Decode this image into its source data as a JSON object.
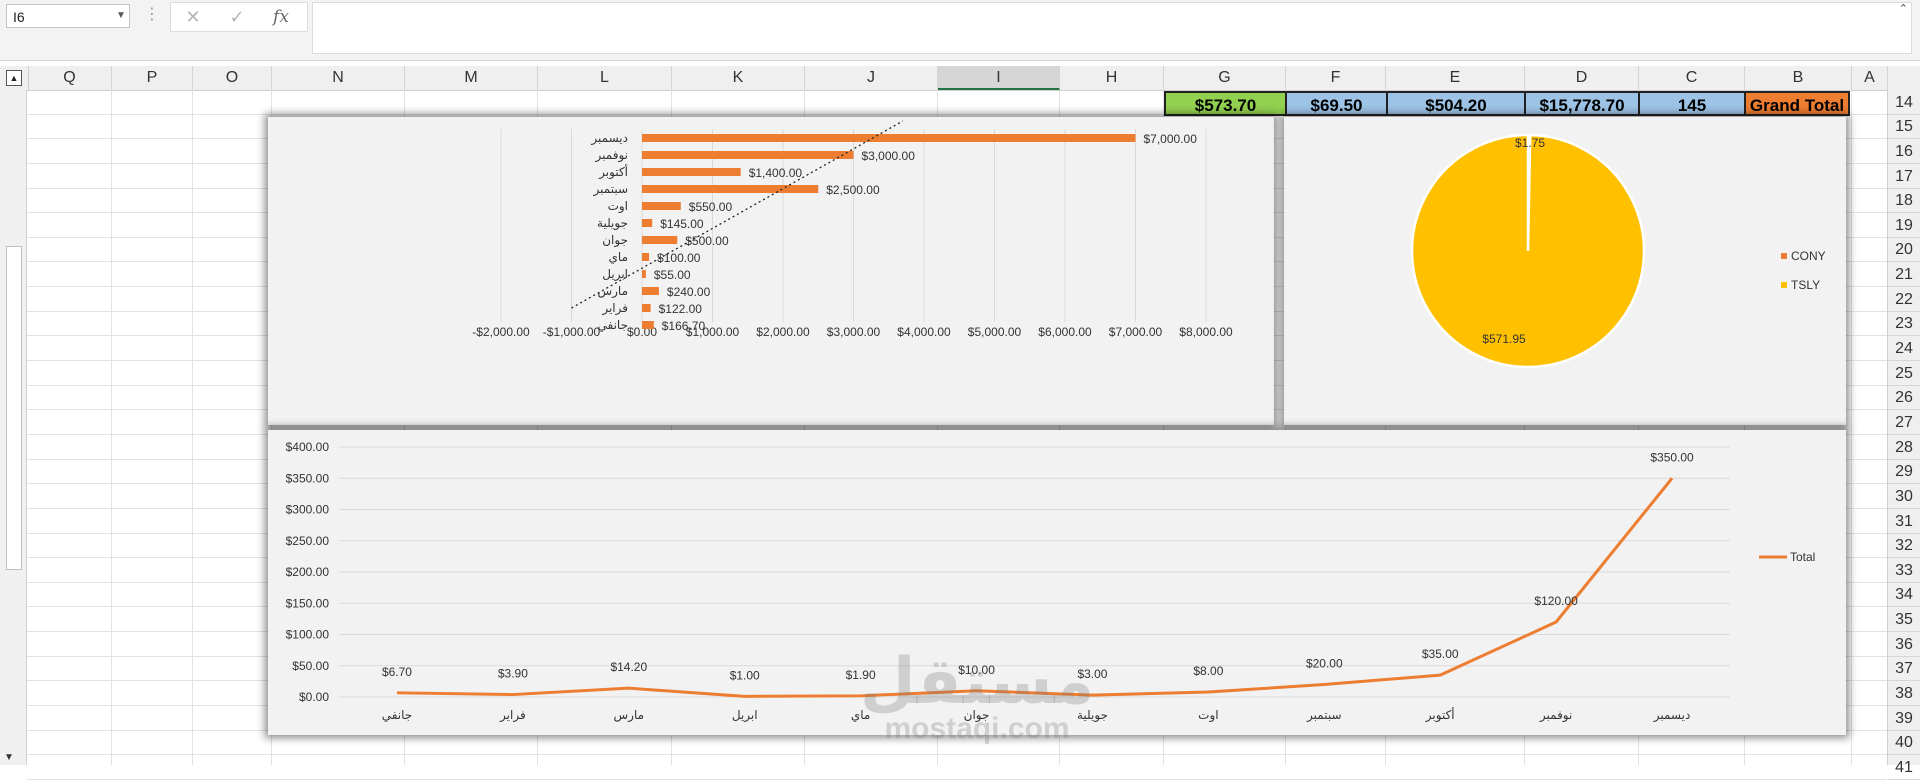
{
  "formula_bar": {
    "name_box": "I6",
    "cancel_icon": "✕",
    "enter_icon": "✓",
    "fx_label": "fx",
    "formula_value": ""
  },
  "columns": [
    "Q",
    "P",
    "O",
    "N",
    "M",
    "L",
    "K",
    "J",
    "I",
    "H",
    "G",
    "F",
    "E",
    "D",
    "C",
    "B",
    "A"
  ],
  "selected_column": "I",
  "rows": [
    "14",
    "15",
    "16",
    "17",
    "18",
    "19",
    "20",
    "21",
    "22",
    "23",
    "24",
    "25",
    "26",
    "27",
    "28",
    "29",
    "30",
    "31",
    "32",
    "33",
    "34",
    "35",
    "36",
    "37",
    "38",
    "39",
    "40",
    "41"
  ],
  "grand_total_row": {
    "G": "$573.70",
    "F": "$69.50",
    "E": "$504.20",
    "D": "$15,778.70",
    "C": "145",
    "B": "Grand Total"
  },
  "colors": {
    "accent_orange": "#ED7D31",
    "pie_yellow": "#FFC000",
    "gt_green": "#92D050",
    "gt_blue": "#9DC3E6",
    "gt_orange": "#ED7D31"
  },
  "watermark": {
    "arabic": "مستقل",
    "latin": "mostaqi.com"
  },
  "chart_data": [
    {
      "type": "bar",
      "orientation": "horizontal",
      "categories": [
        "ديسمبر",
        "نوفمبر",
        "أكتوبر",
        "سبتمبر",
        "اوت",
        "جويلية",
        "جوان",
        "ماي",
        "ابريل",
        "مارس",
        "فراير",
        "جانفي"
      ],
      "values": [
        7000,
        3000,
        1400,
        2500,
        550,
        145,
        500,
        100,
        55,
        240,
        122,
        166.7
      ],
      "data_labels": [
        "$7,000.00",
        "$3,000.00",
        "$1,400.00",
        "$2,500.00",
        "$550.00",
        "$145.00",
        "$500.00",
        "$100.00",
        "$55.00",
        "$240.00",
        "$122.00",
        "$166.70"
      ],
      "x_ticks": [
        "-$2,000.00",
        "-$1,000.00",
        "$0.00",
        "$1,000.00",
        "$2,000.00",
        "$3,000.00",
        "$4,000.00",
        "$5,000.00",
        "$6,000.00",
        "$7,000.00",
        "$8,000.00"
      ],
      "xlim": [
        -2000,
        8000
      ],
      "trendline": "dotted linear",
      "grid": "vertical"
    },
    {
      "type": "pie",
      "slices": [
        {
          "name": "CONY",
          "value": 1.75,
          "label": "$1.75",
          "color": "#ED7D31"
        },
        {
          "name": "TSLY",
          "value": 571.95,
          "label": "$571.95",
          "color": "#FFC000"
        }
      ],
      "legend": [
        "CONY",
        "TSLY"
      ],
      "legend_position": "right"
    },
    {
      "type": "line",
      "categories": [
        "جانفي",
        "فراير",
        "مارس",
        "ابريل",
        "ماي",
        "جوان",
        "جويلية",
        "اوت",
        "سبتمبر",
        "أكتوبر",
        "نوفمبر",
        "ديسمبر"
      ],
      "series": [
        {
          "name": "Total",
          "values": [
            6.7,
            3.9,
            14.2,
            1.0,
            1.9,
            10.0,
            3.0,
            8.0,
            20.0,
            35.0,
            120.0,
            350.0
          ]
        }
      ],
      "data_labels": [
        "$6.70",
        "$3.90",
        "$14.20",
        "$1.00",
        "$1.90",
        "$10.00",
        "$3.00",
        "$8.00",
        "$20.00",
        "$35.00",
        "$120.00",
        "$350.00"
      ],
      "y_ticks": [
        "$0.00",
        "$50.00",
        "$100.00",
        "$150.00",
        "$200.00",
        "$250.00",
        "$300.00",
        "$350.00",
        "$400.00"
      ],
      "ylim": [
        0,
        400
      ],
      "legend_position": "right",
      "grid": "horizontal"
    }
  ]
}
